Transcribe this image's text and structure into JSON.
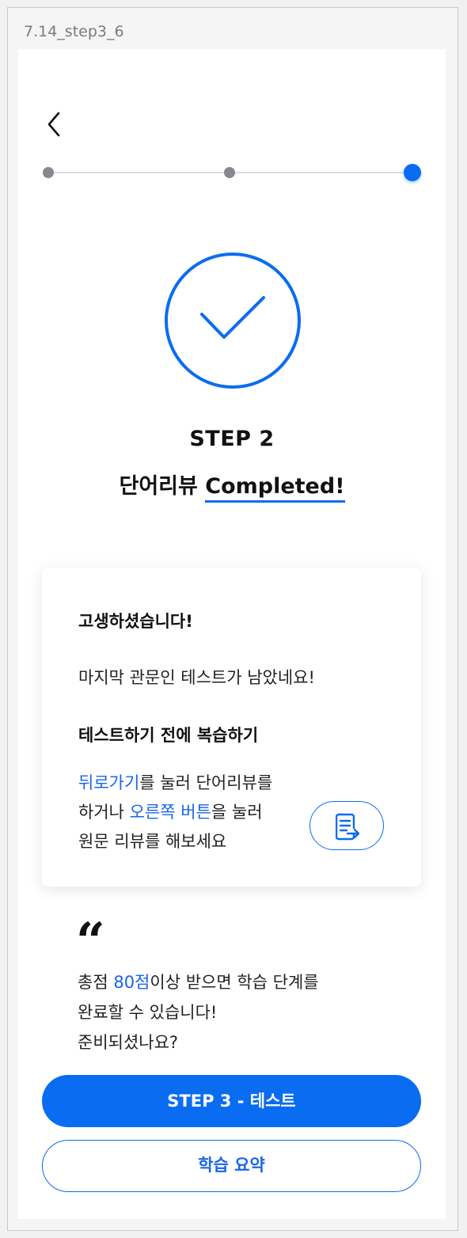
{
  "frame": {
    "label": "7.14_step3_6"
  },
  "header": {
    "back_icon": "chevron-left-icon"
  },
  "progress": {
    "steps": 3,
    "current": 3
  },
  "completion": {
    "icon": "check-circle-icon",
    "step_title": "STEP 2",
    "subtitle_prefix": "단어리뷰 ",
    "subtitle_highlight": "Completed!"
  },
  "card": {
    "title": "고생하셨습니다!",
    "line1": "마지막 관문인 테스트가 남았네요!",
    "subtitle": "테스트하기 전에 복습하기",
    "body": {
      "part1_link": "뒤로가기",
      "part2": "를 눌러 단어리뷰를",
      "part3": "하거나 ",
      "part4_link": "오른쪽 버튼",
      "part5": "을 눌러",
      "part6": "원문 리뷰를 해보세요"
    },
    "doc_button_icon": "document-arrow-icon"
  },
  "quote": {
    "mark": "“",
    "part1": "총점 ",
    "score": "80점",
    "part2": "이상 받으면 학습 단계를",
    "line2": "완료할 수 있습니다!",
    "line3": "준비되셨나요?"
  },
  "buttons": {
    "primary_label": "STEP 3 - 테스트",
    "secondary_label": "학습 요약"
  },
  "colors": {
    "accent": "#0a6cf0",
    "link": "#1a66e6",
    "inactive_dot": "#86888f",
    "track": "#d7dde3"
  }
}
